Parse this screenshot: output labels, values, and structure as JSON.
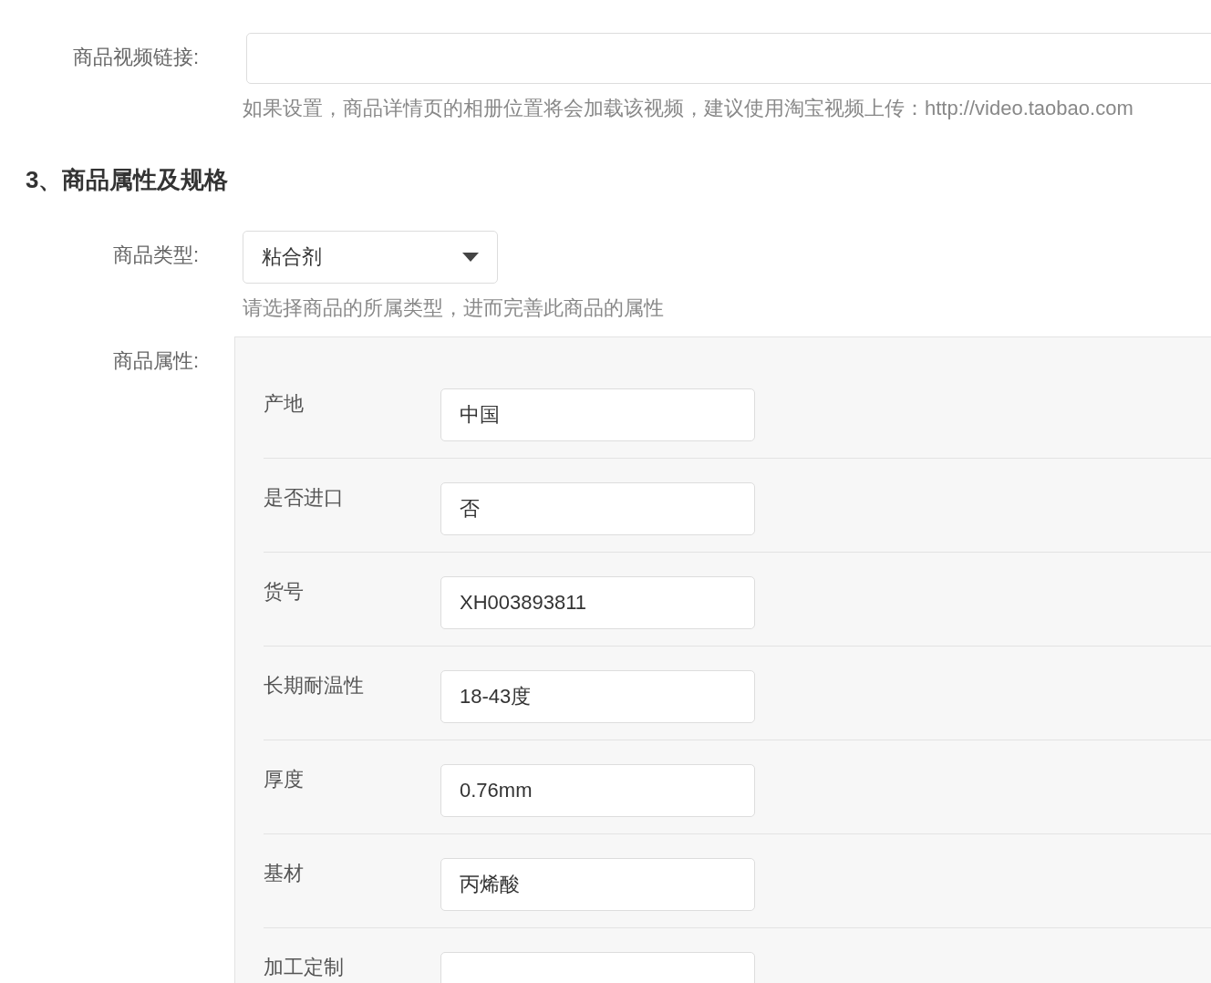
{
  "video_link": {
    "label": "商品视频链接:",
    "hint": "如果设置，商品详情页的相册位置将会加载该视频，建议使用淘宝视频上传：http://video.taobao.com"
  },
  "section_title": "3、商品属性及规格",
  "product_type": {
    "label": "商品类型:",
    "value": "粘合剂",
    "hint": "请选择商品的所属类型，进而完善此商品的属性"
  },
  "attributes": {
    "label": "商品属性:",
    "rows": [
      {
        "name": "产地",
        "value": "中国"
      },
      {
        "name": "是否进口",
        "value": "否"
      },
      {
        "name": "货号",
        "value": "XH003893811"
      },
      {
        "name": "长期耐温性",
        "value": "18-43度"
      },
      {
        "name": "厚度",
        "value": "0.76mm"
      },
      {
        "name": "基材",
        "value": "丙烯酸"
      },
      {
        "name": "加工定制"
      }
    ]
  }
}
